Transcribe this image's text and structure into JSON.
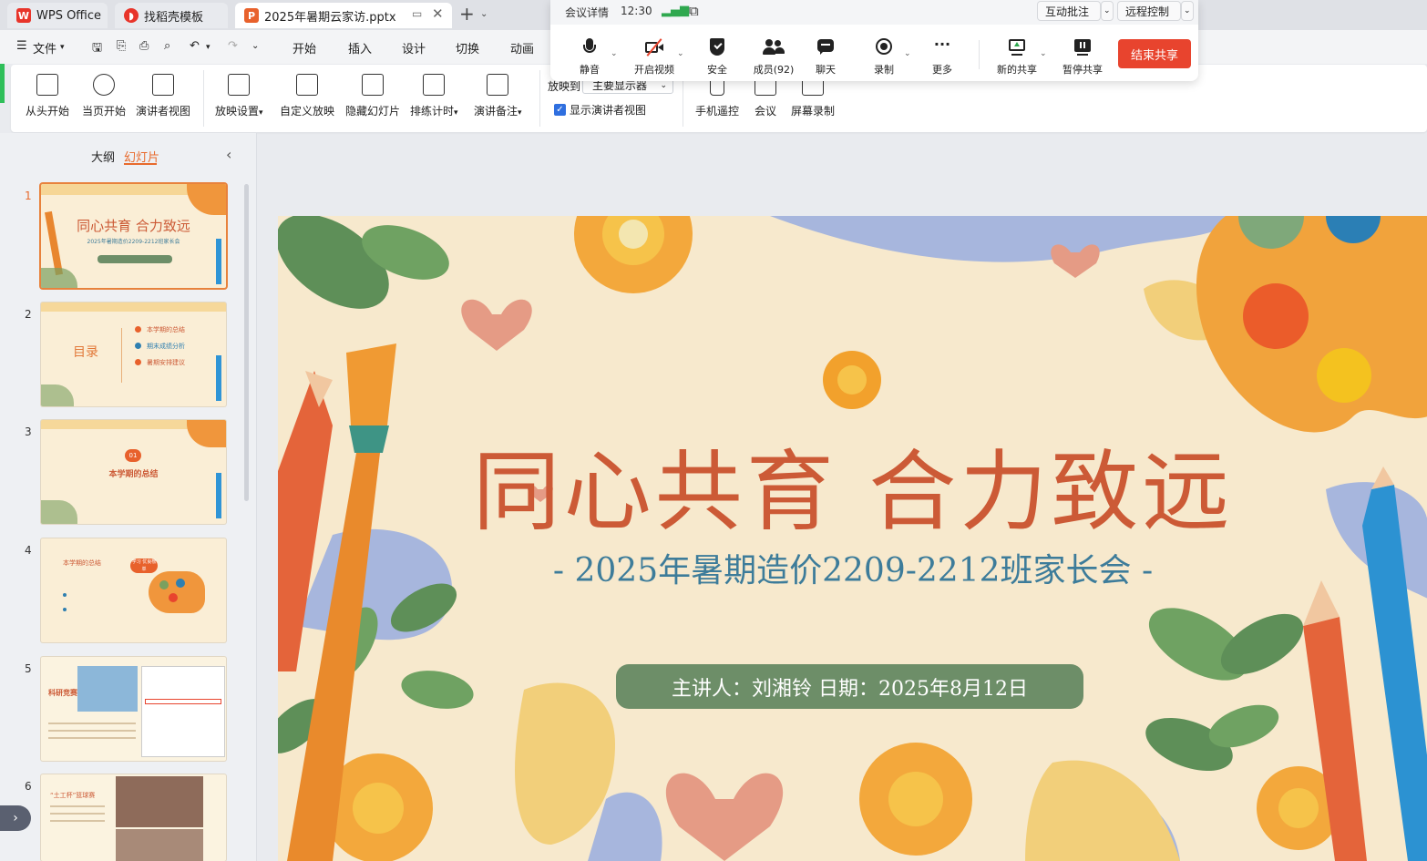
{
  "tabs": {
    "wps": "WPS Office",
    "daoke": "找稻壳模板",
    "file": "2025年暑期云家访.pptx"
  },
  "menu": {
    "file": "文件",
    "items": [
      "开始",
      "插入",
      "设计",
      "切换",
      "动画"
    ]
  },
  "ribbon": {
    "from_start": "从头开始",
    "from_current": "当页开始",
    "presenter_view": "演讲者视图",
    "show_settings": "放映设置",
    "custom_show": "自定义放映",
    "hide_slide": "隐藏幻灯片",
    "rehearse": "排练计时",
    "speaker_notes": "演讲备注",
    "show_on_label": "放映到",
    "show_on_value": "主要显示器",
    "show_presenter_checkbox": "显示演讲者视图",
    "phone_remote": "手机遥控",
    "meeting": "会议",
    "screen_record": "屏幕录制"
  },
  "meeting": {
    "details": "会议详情",
    "time": "12:30",
    "interactive_annotate": "互动批注",
    "remote_control": "远程控制",
    "mute": "静音",
    "start_video": "开启视频",
    "security": "安全",
    "members": "成员(92)",
    "chat": "聊天",
    "record": "录制",
    "more": "更多",
    "new_share": "新的共享",
    "pause_share": "暂停共享",
    "end_share": "结束共享"
  },
  "panel": {
    "outline": "大纲",
    "slides": "幻灯片"
  },
  "thumbnails": [
    {
      "num": "1",
      "title": "同心共育  合力致远",
      "sub": "2025年暑期造价2209-2212班家长会"
    },
    {
      "num": "2",
      "title": "目录",
      "items": [
        "本学期的总结",
        "期末成绩分析",
        "暑期安排建议"
      ]
    },
    {
      "num": "3",
      "title": "本学期的总结",
      "badge": "01"
    },
    {
      "num": "4",
      "title": "本学期的总结",
      "badge": "学习 优良榜单"
    },
    {
      "num": "5",
      "title": "科研竞赛"
    },
    {
      "num": "6",
      "title": "“土工杯”篮球赛"
    }
  ],
  "slide": {
    "title": "同心共育  合力致远",
    "subtitle": "- 2025年暑期造价2209-2212班家长会 -",
    "presenter": "主讲人：刘湘铃    日期：2025年8月12日"
  },
  "colors": {
    "title": "#cc5a36",
    "subtitle": "#3d7c9a",
    "presenter_bg": "#6d8e68",
    "end_share": "#e8442e",
    "slide_bg": "#f7e9cd"
  }
}
